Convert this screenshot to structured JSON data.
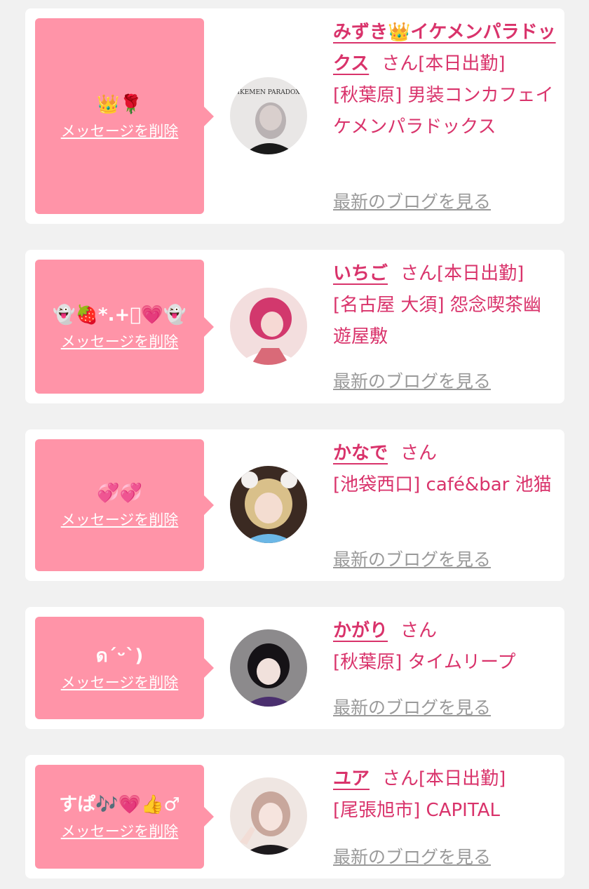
{
  "delete_label": "メッセージを削除",
  "blog_label": "最新のブログを見る",
  "colors": {
    "accent": "#d9336b",
    "bubble": "#ff94a8",
    "link_gray": "#9a9a9a",
    "background": "#f1f1f1"
  },
  "messages": [
    {
      "emoji": "👑🌹",
      "name": "みずき👑イケメンパラドックス",
      "suffix": "さん[本日出勤]",
      "shop": "[秋葉原] 男装コンカフェイケメンパラドックス",
      "avatar_caption": "IKEMEN PARADOX"
    },
    {
      "emoji": "👻🍓*.+ﾟ💗👻",
      "name": "いちご",
      "suffix": "さん[本日出勤]",
      "shop": "[名古屋 大須] 怨念喫茶幽遊屋敷"
    },
    {
      "emoji": "💞💞",
      "name": "かなで",
      "suffix": "さん",
      "shop": "[池袋西口] café&bar 池猫"
    },
    {
      "emoji": "ดˊᵕˋ)",
      "name": "かがり",
      "suffix": "さん",
      "shop": "[秋葉原] タイムリープ"
    },
    {
      "emoji": "すぱ🎶💗👍♂",
      "name": "ユア",
      "suffix": "さん[本日出勤]",
      "shop": "[尾張旭市] CAPITAL"
    }
  ]
}
